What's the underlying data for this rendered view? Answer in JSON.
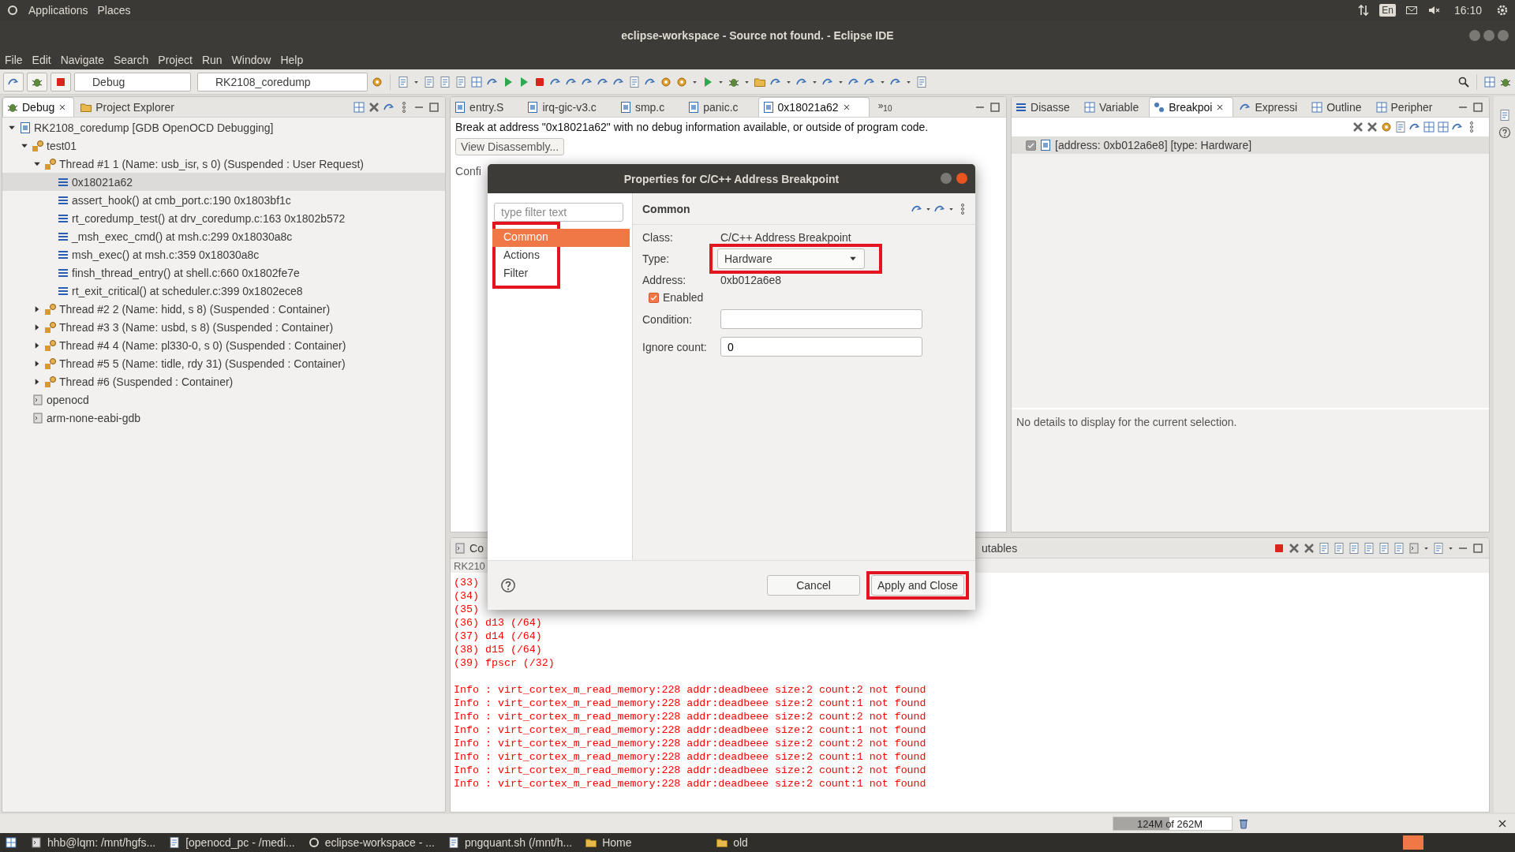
{
  "top_panel": {
    "menus": [
      "Applications",
      "Places"
    ],
    "keyboard": "En",
    "clock": "16:10"
  },
  "window": {
    "title": "eclipse-workspace - Source not found. - Eclipse IDE"
  },
  "menu_bar": [
    "File",
    "Edit",
    "Navigate",
    "Search",
    "Project",
    "Run",
    "Window",
    "Help"
  ],
  "toolbar": {
    "launch_mode": "Debug",
    "launch_config": "RK2108_coredump"
  },
  "debug_view": {
    "tabs": [
      {
        "label": "Debug",
        "selected": true
      },
      {
        "label": "Project Explorer",
        "selected": false
      }
    ],
    "tree": [
      {
        "label": "RK2108_coredump [GDB OpenOCD Debugging]",
        "kind": "launch",
        "expanded": true,
        "selected": false,
        "children": [
          {
            "label": "test01",
            "kind": "process",
            "expanded": true,
            "selected": false,
            "children": [
              {
                "label": "Thread #1 1 (Name: usb_isr, s 0) (Suspended : User Request)",
                "kind": "thread",
                "expanded": true,
                "selected": false,
                "children": [
                  {
                    "label": "0x18021a62",
                    "kind": "frame",
                    "selected": true
                  },
                  {
                    "label": "assert_hook() at cmb_port.c:190 0x1803bf1c",
                    "kind": "frame",
                    "selected": false
                  },
                  {
                    "label": "rt_coredump_test() at drv_coredump.c:163 0x1802b572",
                    "kind": "frame",
                    "selected": false
                  },
                  {
                    "label": "_msh_exec_cmd() at msh.c:299 0x18030a8c",
                    "kind": "frame",
                    "selected": false
                  },
                  {
                    "label": "msh_exec() at msh.c:359 0x18030a8c",
                    "kind": "frame",
                    "selected": false
                  },
                  {
                    "label": "finsh_thread_entry() at shell.c:660 0x1802fe7e",
                    "kind": "frame",
                    "selected": false
                  },
                  {
                    "label": "rt_exit_critical() at scheduler.c:399 0x1802ece8",
                    "kind": "frame",
                    "selected": false
                  }
                ]
              },
              {
                "label": "Thread #2 2 (Name: hidd, s 8) (Suspended : Container)",
                "kind": "thread",
                "expanded": false,
                "selected": false
              },
              {
                "label": "Thread #3 3 (Name: usbd, s 8) (Suspended : Container)",
                "kind": "thread",
                "expanded": false,
                "selected": false
              },
              {
                "label": "Thread #4 4 (Name: pl330-0, s 0) (Suspended : Container)",
                "kind": "thread",
                "expanded": false,
                "selected": false
              },
              {
                "label": "Thread #5 5 (Name: tidle, rdy 31) (Suspended : Container)",
                "kind": "thread",
                "expanded": false,
                "selected": false
              },
              {
                "label": "Thread #6 (Suspended : Container)",
                "kind": "thread",
                "expanded": false,
                "selected": false
              }
            ]
          },
          {
            "label": "openocd",
            "kind": "program",
            "selected": false
          },
          {
            "label": "arm-none-eabi-gdb",
            "kind": "program",
            "selected": false
          }
        ]
      }
    ]
  },
  "editor": {
    "tabs": [
      {
        "label": "entry.S",
        "selected": false
      },
      {
        "label": "irq-gic-v3.c",
        "selected": false
      },
      {
        "label": "smp.c",
        "selected": false
      },
      {
        "label": "panic.c",
        "selected": false
      },
      {
        "label": "0x18021a62",
        "selected": true
      }
    ],
    "overflow": "»$_{10}$",
    "message": "Break at address \"0x18021a62\" with no debug information available, or outside of program code.",
    "button": "View Disassembly...",
    "section": "Confi"
  },
  "side_view": {
    "tabs": [
      {
        "label": "Disasse",
        "selected": false
      },
      {
        "label": "Variable",
        "selected": false
      },
      {
        "label": "Breakpoi",
        "selected": true
      },
      {
        "label": "Expressi",
        "selected": false
      },
      {
        "label": "Outline",
        "selected": false
      },
      {
        "label": "Peripher",
        "selected": false
      }
    ],
    "breakpoints": [
      {
        "label": "[address: 0xb012a6e8] [type: Hardware]",
        "checked": true
      }
    ],
    "details": "No details to display for the current selection."
  },
  "console": {
    "tabs": [
      "Co",
      "utables"
    ],
    "header": "RK210",
    "lines": [
      "(33)",
      "(34)",
      "(35)",
      "(36) d13 (/64)",
      "(37) d14 (/64)",
      "(38) d15 (/64)",
      "(39) fpscr (/32)"
    ],
    "log": [
      "Info : virt_cortex_m_read_memory:228 addr:deadbeee size:2 count:2 not found",
      "Info : virt_cortex_m_read_memory:228 addr:deadbeee size:2 count:1 not found",
      "Info : virt_cortex_m_read_memory:228 addr:deadbeee size:2 count:2 not found",
      "Info : virt_cortex_m_read_memory:228 addr:deadbeee size:2 count:1 not found",
      "Info : virt_cortex_m_read_memory:228 addr:deadbeee size:2 count:2 not found",
      "Info : virt_cortex_m_read_memory:228 addr:deadbeee size:2 count:1 not found",
      "Info : virt_cortex_m_read_memory:228 addr:deadbeee size:2 count:2 not found",
      "Info : virt_cortex_m_read_memory:228 addr:deadbeee size:2 count:1 not found"
    ]
  },
  "dialog": {
    "title": "Properties for C/C++ Address Breakpoint",
    "filter": {
      "placeholder": "type filter text"
    },
    "nav": [
      {
        "label": "Common",
        "selected": true
      },
      {
        "label": "Actions",
        "selected": false
      },
      {
        "label": "Filter",
        "selected": false
      }
    ],
    "nav_highlighted": true,
    "page_title": "Common",
    "class_label": "Class:",
    "class_value": "C/C++ Address Breakpoint",
    "type": {
      "label": "Type:",
      "value": "Hardware",
      "highlighted": true
    },
    "address_label": "Address:",
    "address_value": "0xb012a6e8",
    "enabled": {
      "label": "Enabled",
      "checked": true
    },
    "condition": {
      "label": "Condition:"
    },
    "ignore_count": {
      "label": "Ignore count:",
      "value": "0"
    },
    "buttons": [
      {
        "label": "Cancel",
        "highlighted": false
      },
      {
        "label": "Apply and Close",
        "highlighted": true
      }
    ]
  },
  "status_bar": {
    "memory": "124M of 262M",
    "level": 0.47
  },
  "taskbar": [
    "hhb@lqm: /mnt/hgfs...",
    "[openocd_pc - /medi...",
    "eclipse-workspace - ...",
    "pngquant.sh (/mnt/h...",
    "Home",
    "old"
  ]
}
